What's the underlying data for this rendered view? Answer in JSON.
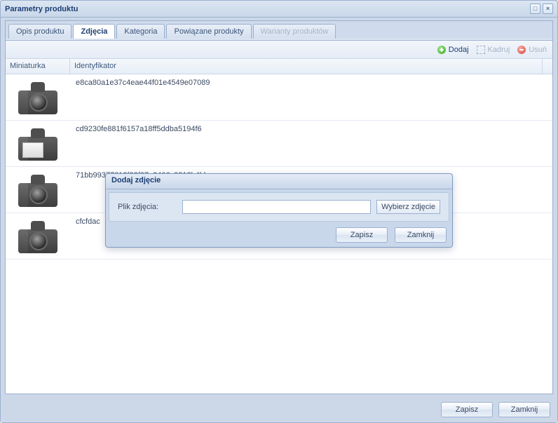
{
  "window": {
    "title": "Parametry produktu"
  },
  "tabs": {
    "opis": "Opis produktu",
    "zdjecia": "Zdjęcia",
    "kategoria": "Kategoria",
    "powiazane": "Powiązane produkty",
    "warianty": "Warianty produktów"
  },
  "toolbar": {
    "dodaj": "Dodaj",
    "kadruj": "Kadruj",
    "usun": "Usuń"
  },
  "grid": {
    "col_thumb": "Miniaturka",
    "col_ident": "Identyfikator",
    "rows": [
      {
        "thumb_view": "front",
        "ident": "e8ca80a1e37c4eae44f01e4549e07089"
      },
      {
        "thumb_view": "back",
        "ident": "cd9230fe881f6157a18ff5ddba5194f6"
      },
      {
        "thumb_view": "front",
        "ident": "71bb99377613f32f27e2406c8212b4bb"
      },
      {
        "thumb_view": "front",
        "ident": "cfcfdac"
      }
    ]
  },
  "dialog": {
    "title": "Dodaj zdjęcie",
    "file_label": "Plik zdjęcia:",
    "file_value": "",
    "choose_label": "Wybierz zdjęcie",
    "save_label": "Zapisz",
    "close_label": "Zamknij"
  },
  "buttons": {
    "save": "Zapisz",
    "close": "Zamknij"
  }
}
